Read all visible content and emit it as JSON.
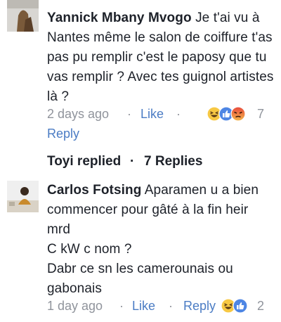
{
  "comments": [
    {
      "author": "Yannick Mbany Mvogo",
      "text": "Je t'ai vu à Nantes même le salon de coiffure t'as pas pu remplir c'est le paposy que tu vas remplir ? Avec tes guignol artistes là ?",
      "time": "2 days ago",
      "like": "Like",
      "reply": "Reply",
      "reaction_count": "7",
      "reactions": [
        "haha-icon",
        "like-icon",
        "angry-icon"
      ]
    },
    {
      "author": "Carlos Fotsing",
      "text_lines": [
        "Aparamen u a bien",
        "commencer pour gâté à la fin heir",
        "mrd",
        "C kW c nom ?",
        "Dabr ce sn les camerounais ou",
        "gabonais"
      ],
      "time": "1 day ago",
      "like": "Like",
      "reply": "Reply",
      "reaction_count": "2",
      "reactions": [
        "haha-icon",
        "like-icon"
      ]
    }
  ],
  "replies_bar": {
    "replied": "Toyi replied",
    "count": "7 Replies"
  },
  "separator": "·",
  "colors": {
    "link": "#4b7cc4",
    "meta": "#90949c",
    "text": "#1d2129"
  }
}
